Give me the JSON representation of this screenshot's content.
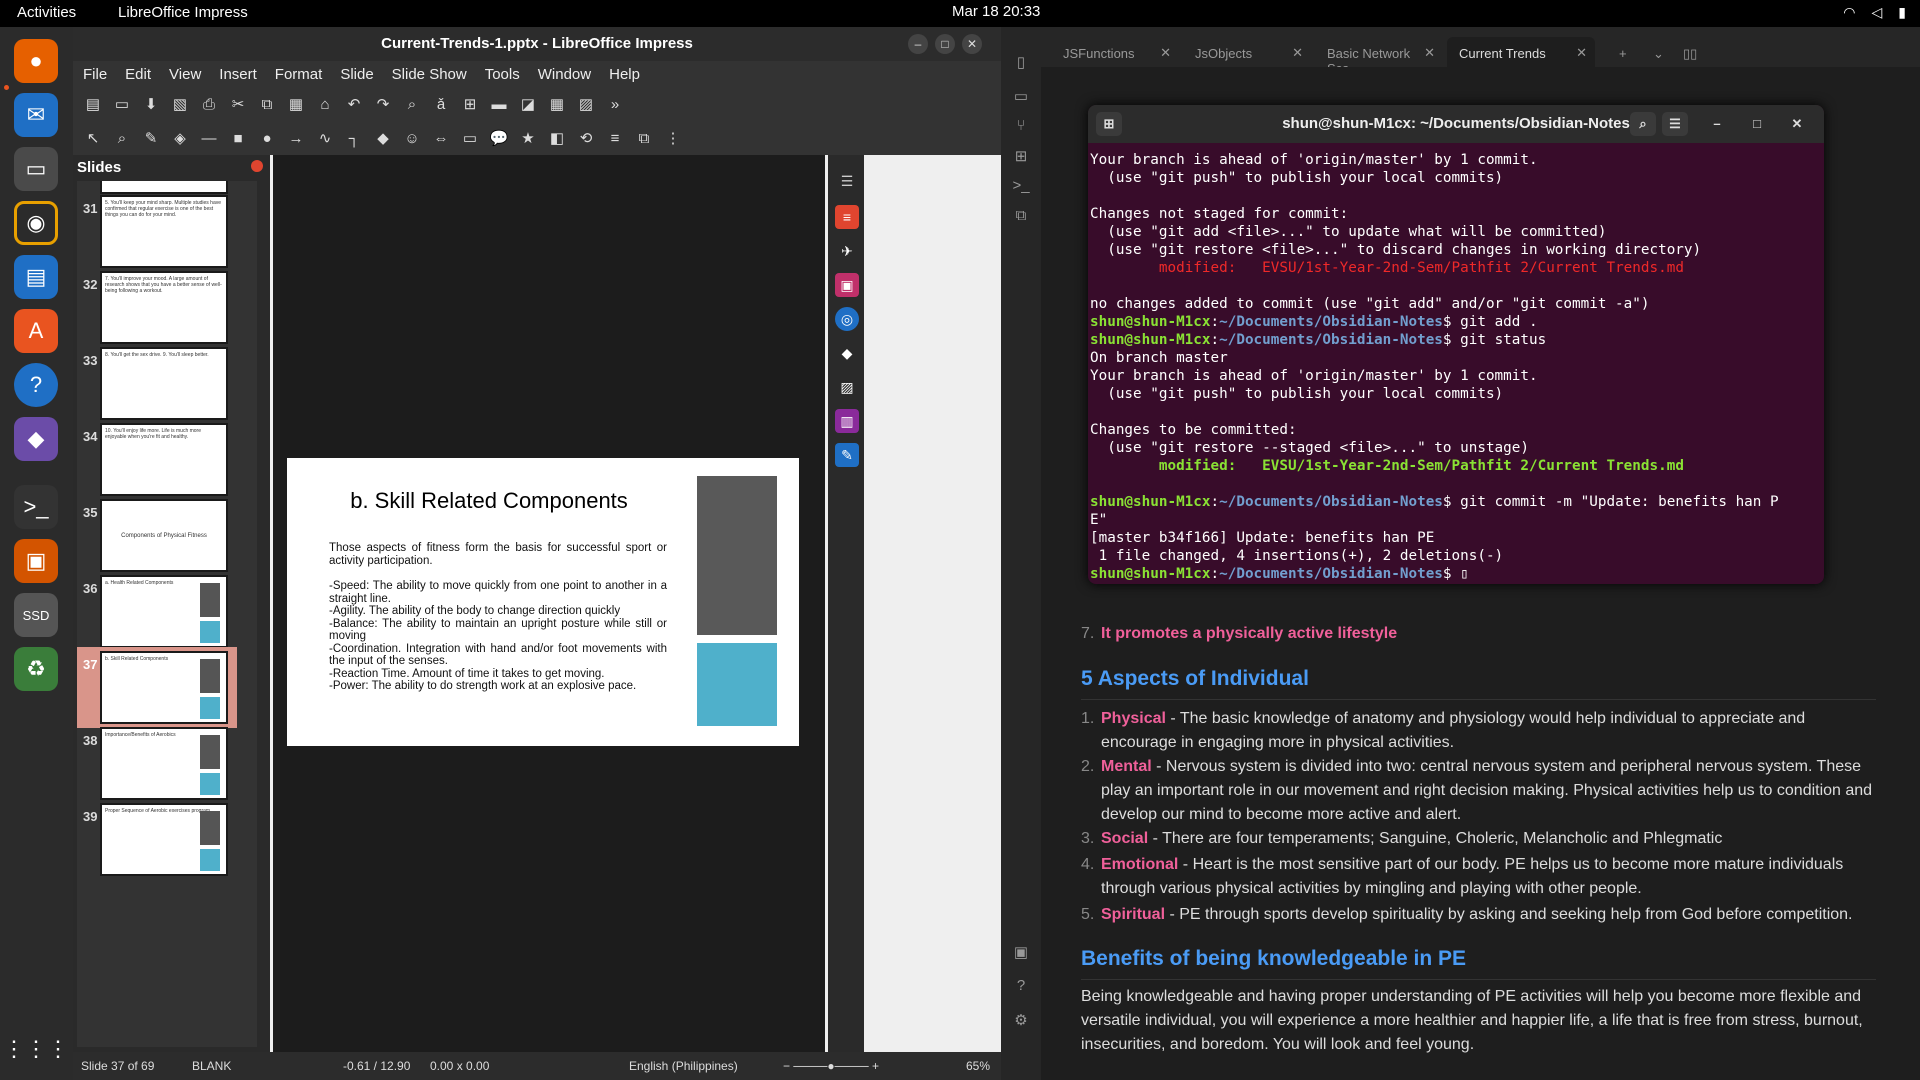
{
  "topbar": {
    "activities": "Activities",
    "app": "LibreOffice Impress",
    "clock": "Mar 18  20:33"
  },
  "impress": {
    "title": "Current-Trends-1.pptx - LibreOffice Impress",
    "menu": [
      "File",
      "Edit",
      "View",
      "Insert",
      "Format",
      "Slide",
      "Slide Show",
      "Tools",
      "Window",
      "Help"
    ],
    "slides_label": "Slides",
    "thumbs": [
      {
        "num": "31",
        "text": "5. You'll keep your mind sharp. Multiple studies have confirmed that regular exercise is one of the best things you can do for your mind."
      },
      {
        "num": "32",
        "text": "7. You'll improve your mood. A large amount of research shows that you have a better sense of well-being following a workout."
      },
      {
        "num": "33",
        "text": "8. You'll get the sex drive. 9. You'll sleep better."
      },
      {
        "num": "34",
        "text": "10. You'll enjoy life more. Life is much more enjoyable when you're fit and healthy."
      },
      {
        "num": "35",
        "text": "Components of Physical Fitness"
      },
      {
        "num": "36",
        "text": "a. Health Related Components"
      },
      {
        "num": "37",
        "text": "b. Skill Related Components"
      },
      {
        "num": "38",
        "text": "Importance/Benefits of Aerobics"
      },
      {
        "num": "39",
        "text": "Proper Sequence of Aerobic exercises program"
      }
    ],
    "slide": {
      "title": "b. Skill Related Components",
      "intro": "Those aspects of fitness form the basis for successful sport or activity participation.",
      "lines": [
        "-Speed: The ability to move quickly from one point to another in a straight line.",
        "-Agility. The ability of the body to change direction quickly",
        "-Balance: The ability to maintain an upright posture while still or moving",
        "-Coordination. Integration with hand and/or foot movements with the input of the senses.",
        "-Reaction Time. Amount of time it takes to get moving.",
        "-Power: The ability to do strength work at an explosive pace."
      ]
    },
    "status": {
      "slide": "Slide 37 of 69",
      "layout": "BLANK",
      "pos": "-0.61 / 12.90",
      "size": "0.00 x 0.00",
      "lang": "English (Philippines)",
      "zoom": "65%"
    }
  },
  "obsidian": {
    "tabs": [
      "JSFunctions",
      "JsObjects",
      "Basic Network Sca...",
      "Current Trends"
    ],
    "item7": "It promotes a physically active lifestyle",
    "h_aspects": "5 Aspects of Individual",
    "aspects": [
      {
        "n": "1.",
        "k": "Physical",
        "t": " - The basic knowledge of anatomy and physiology would help individual to appreciate and encourage in engaging more in physical activities."
      },
      {
        "n": "2.",
        "k": "Mental",
        "t": " - Nervous system is divided into two: central nervous system and peripheral nervous system. These play an important role in our movement and right decision making. Physical activities help us to condition and develop our mind to become more active and alert."
      },
      {
        "n": "3.",
        "k": "Social",
        "t": "  - There are four temperaments; Sanguine, Choleric, Melancholic and Phlegmatic"
      },
      {
        "n": "4.",
        "k": "Emotional",
        "t": " - Heart is the most sensitive part of our body. PE helps us to become more mature individuals through various physical activities by mingling and playing with other people."
      },
      {
        "n": "5.",
        "k": "Spiritual",
        "t": " - PE through sports develop spirituality by asking and seeking help from God before competition."
      }
    ],
    "h_benefits": "Benefits of being knowledgeable in PE",
    "benefits": "Being knowledgeable and having proper understanding of PE activities will help you become more flexible and versatile individual, you will experience a more healthier and happier life, a life that is free from stress, burnout, insecurities, and boredom. You will look and feel young."
  },
  "terminal": {
    "title": "shun@shun-M1cx: ~/Documents/Obsidian-Notes",
    "prompt_user": "shun@shun-M1cx",
    "prompt_path": "~/Documents/Obsidian-Notes",
    "l1": "Your branch is ahead of 'origin/master' by 1 commit.",
    "l2": "  (use \"git push\" to publish your local commits)",
    "l3": "Changes not staged for commit:",
    "l4": "  (use \"git add <file>...\" to update what will be committed)",
    "l5": "  (use \"git restore <file>...\" to discard changes in working directory)",
    "l6": "\tmodified:   EVSU/1st-Year-2nd-Sem/Pathfit 2/Current Trends.md",
    "l7": "no changes added to commit (use \"git add\" and/or \"git commit -a\")",
    "c1": "$ git add .",
    "c2": "$ git status",
    "l8": "On branch master",
    "l9": "Changes to be committed:",
    "l10": "  (use \"git restore --staged <file>...\" to unstage)",
    "c3": "$ git commit -m \"Update: benefits han P",
    "l11": "E\"",
    "l12": "[master b34f166] Update: benefits han PE",
    "l13": " 1 file changed, 4 insertions(+), 2 deletions(-)",
    "c4": "$ "
  }
}
